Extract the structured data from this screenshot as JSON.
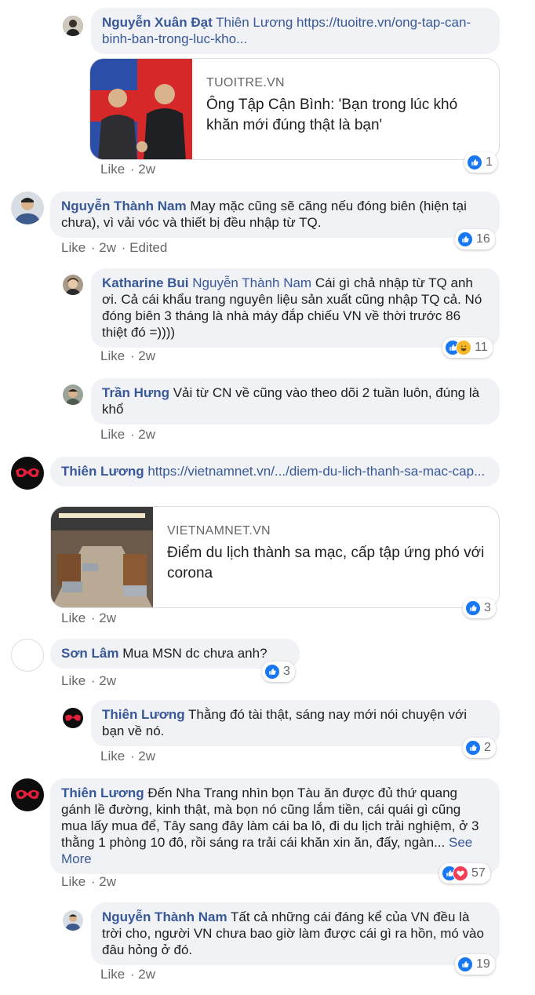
{
  "comments": [
    {
      "author": "Nguyễn Xuân Đạt",
      "mention": "Thiên Lương",
      "link_text": "https://tuoitre.vn/ong-tap-can-binh-ban-trong-luc-kho...",
      "card": {
        "domain": "TUOITRE.VN",
        "title": "Ông Tập Cận Bình: 'Bạn trong lúc khó khăn mới đúng thật là bạn'"
      },
      "like": "Like",
      "time": "2w",
      "reaction_count": "1"
    },
    {
      "author": "Nguyễn Thành Nam",
      "text": "May mặc cũng sẽ căng nếu đóng biên (hiện tại chưa), vì vải vóc và thiết bị đều nhập từ TQ.",
      "like": "Like",
      "time": "2w",
      "edited": "Edited",
      "reaction_count": "16"
    },
    {
      "author": "Katharine Bui",
      "mention": "Nguyễn Thành Nam",
      "text": "Cái gì chả nhập từ TQ anh ơi. Cả cái khẩu trang nguyên liệu sản xuất cũng nhập TQ cả. Nó đóng biên 3 tháng là nhà máy đắp chiếu VN về thời trước 86 thiệt đó =))))",
      "like": "Like",
      "time": "2w",
      "reaction_count": "11"
    },
    {
      "author": "Trần Hưng",
      "text": "Vải từ CN về cũng vào theo dõi 2 tuần luôn, đúng là khổ",
      "like": "Like",
      "time": "2w"
    },
    {
      "author": "Thiên Lương",
      "link_text": "https://vietnamnet.vn/.../diem-du-lich-thanh-sa-mac-cap...",
      "card": {
        "domain": "VIETNAMNET.VN",
        "title": "Điểm du lịch thành sa mạc, cấp tập ứng phó với corona"
      },
      "like": "Like",
      "time": "2w",
      "reaction_count": "3"
    },
    {
      "author": "Sơn Lâm",
      "text": "Mua MSN dc chưa anh?",
      "like": "Like",
      "time": "2w",
      "reaction_count": "3"
    },
    {
      "author": "Thiên Lương",
      "text": "Thằng đó tài thật, sáng nay mới nói chuyện với bạn về nó.",
      "like": "Like",
      "time": "2w",
      "reaction_count": "2"
    },
    {
      "author": "Thiên Lương",
      "text": "Đến Nha Trang nhìn bọn Tàu ăn được đủ thứ quang gánh lề đường, kinh thật, mà bọn nó cũng lắm tiền, cái quái gì cũng mua lấy mua để, Tây sang đây làm cái ba lô, đi du lịch trải nghiệm, ở 3 thằng 1 phòng 10 đô, rồi sáng ra trải cái khăn xin ăn, đấy, ngàn...",
      "see_more": "See More",
      "like": "Like",
      "time": "2w",
      "reaction_count": "57"
    },
    {
      "author": "Nguyễn Thành Nam",
      "text": "Tất cả những cái đáng kể của VN đều là trời cho, người VN chưa bao giờ làm được cái gì ra hồn, mó vào đâu hỏng ở đó.",
      "like": "Like",
      "time": "2w",
      "reaction_count": "19"
    }
  ],
  "colors": {
    "author": "#385898",
    "bubble": "#f0f2f5",
    "like": "#1877f2",
    "haha": "#f7b928",
    "love": "#f33e58",
    "meta": "#65676b"
  }
}
